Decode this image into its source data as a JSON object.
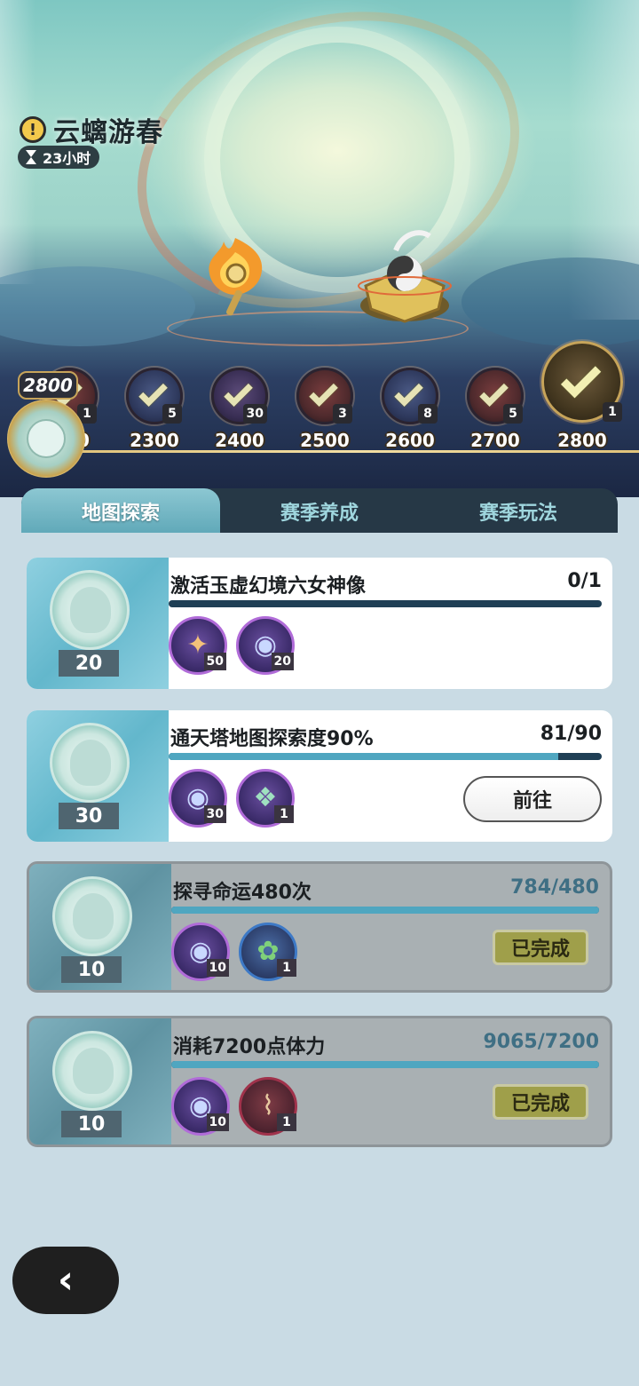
{
  "event": {
    "title": "云螭游春",
    "timer": "23小时",
    "current_score": "2800"
  },
  "track": {
    "nodes": [
      {
        "label": "",
        "count": "1",
        "style": "red"
      },
      {
        "label": "2300",
        "count": "5",
        "style": "blue"
      },
      {
        "label": "2400",
        "count": "30",
        "style": "purple"
      },
      {
        "label": "2500",
        "count": "3",
        "style": "red"
      },
      {
        "label": "2600",
        "count": "8",
        "style": "blue"
      },
      {
        "label": "2700",
        "count": "5",
        "style": "red"
      },
      {
        "label": "2800",
        "count": "1",
        "style": "big"
      }
    ],
    "partial_label": "0"
  },
  "tabs": [
    {
      "label": "地图探索",
      "active": true
    },
    {
      "label": "赛季养成",
      "active": false
    },
    {
      "label": "赛季玩法",
      "active": false
    }
  ],
  "tasks": [
    {
      "coin_value": "20",
      "title": "激活玉虚幻境六女神像",
      "progress": "0/1",
      "progress_fraction": 0,
      "items": [
        {
          "icon": "star-crystal-icon",
          "count": "50"
        },
        {
          "icon": "fate-orb-icon",
          "count": "20"
        }
      ],
      "action": "",
      "done": false
    },
    {
      "coin_value": "30",
      "title": "通天塔地图探索度90%",
      "progress": "81/90",
      "progress_fraction": 0.9,
      "items": [
        {
          "icon": "fate-orb-icon",
          "count": "30"
        },
        {
          "icon": "gem-bouquet-icon",
          "count": "1"
        }
      ],
      "action": "前往",
      "done": false
    },
    {
      "coin_value": "10",
      "title": "探寻命运480次",
      "progress": "784/480",
      "progress_fraction": 1,
      "items": [
        {
          "icon": "fate-orb-icon",
          "count": "10"
        },
        {
          "icon": "herb-dish-icon",
          "count": "1"
        }
      ],
      "action": "已完成",
      "done": true
    },
    {
      "coin_value": "10",
      "title": "消耗7200点体力",
      "progress": "9065/7200",
      "progress_fraction": 1,
      "items": [
        {
          "icon": "fate-orb-icon",
          "count": "10"
        },
        {
          "icon": "scroll-icon",
          "count": "1"
        }
      ],
      "action": "已完成",
      "done": true
    }
  ],
  "nav": {
    "back_icon": "chevron-left-icon"
  }
}
